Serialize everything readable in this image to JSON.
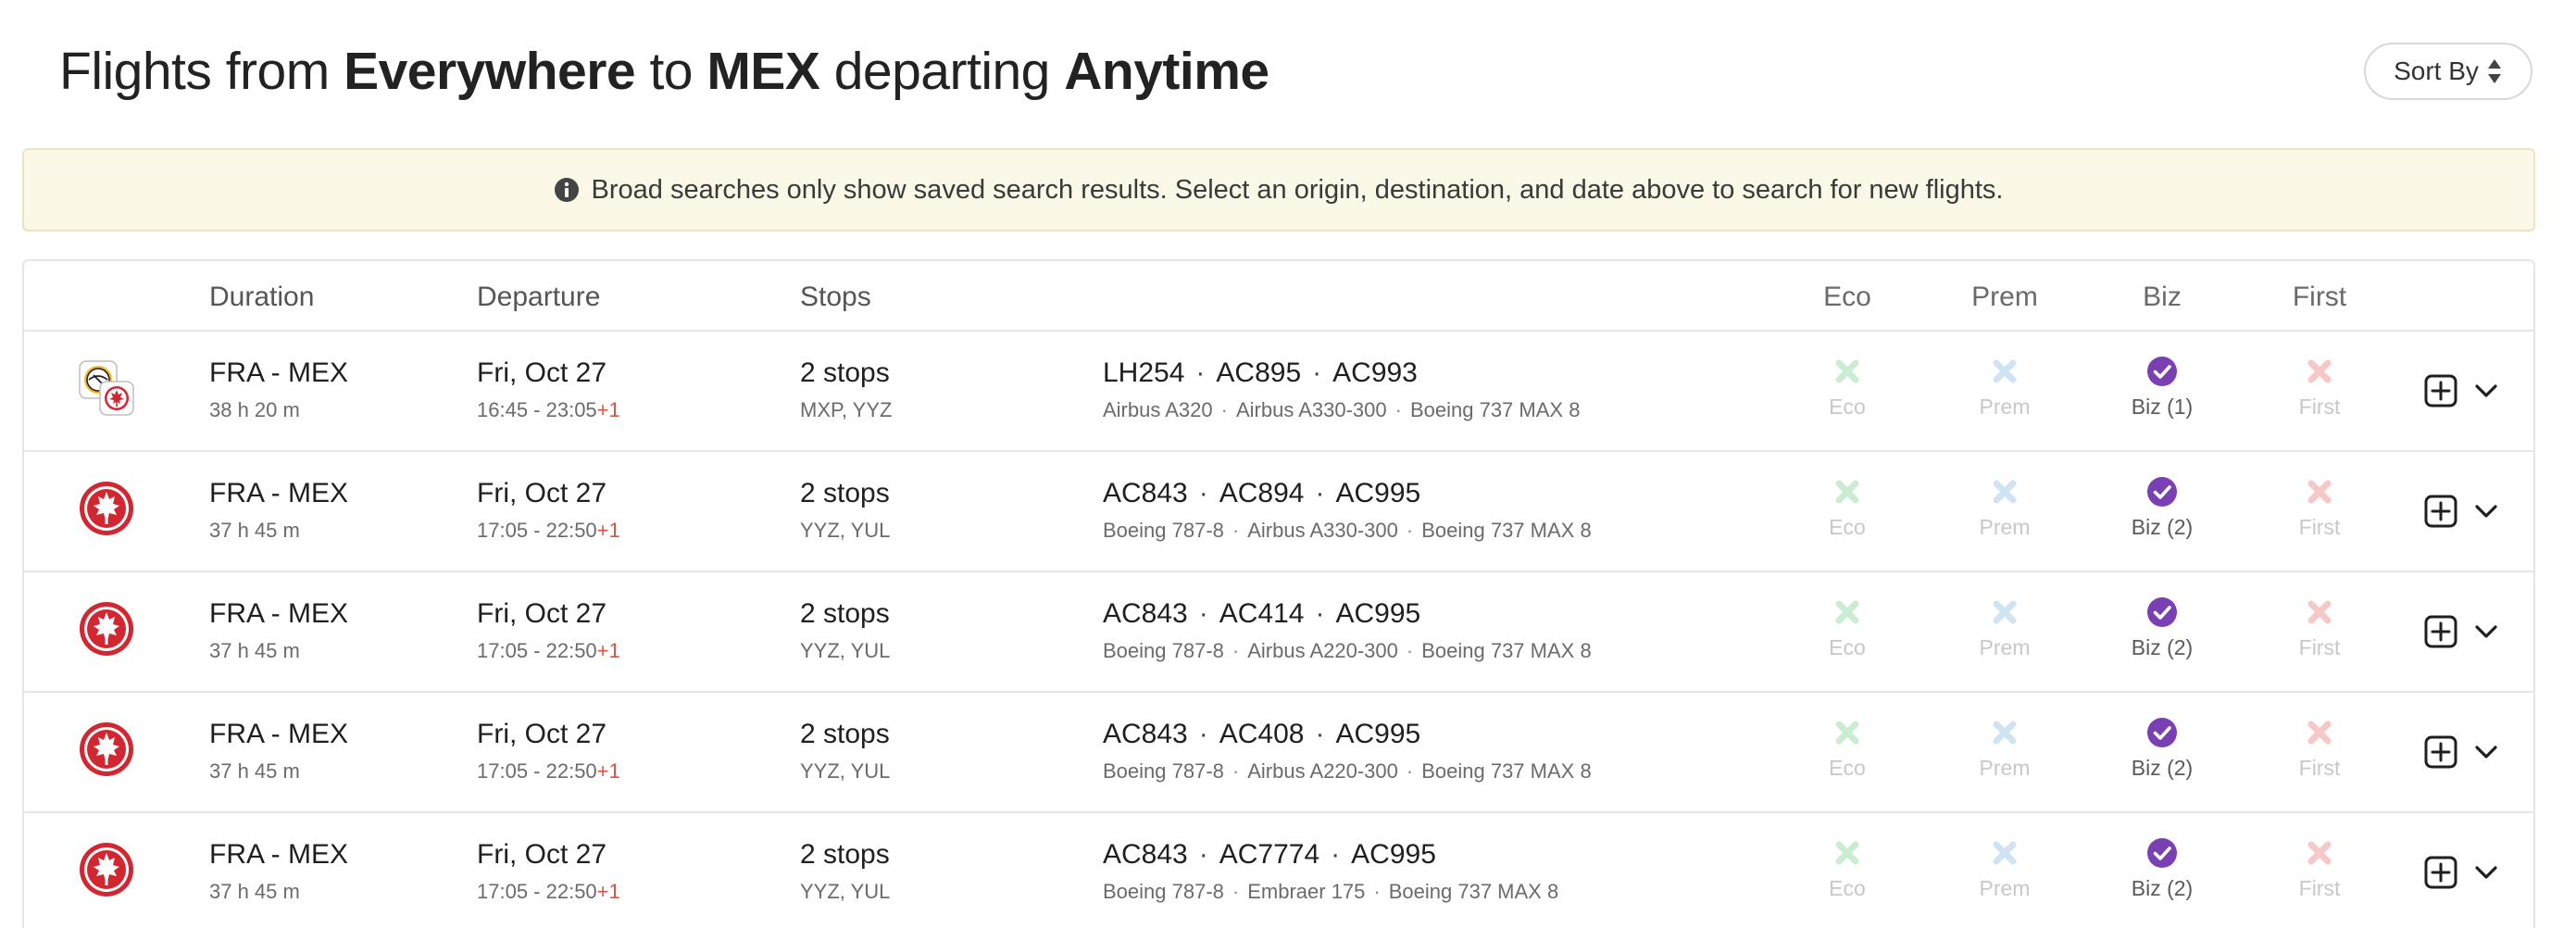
{
  "header": {
    "prefix": "Flights from ",
    "origin": "Everywhere",
    "middle": " to ",
    "destination": "MEX",
    "departing_word": " departing ",
    "when": "Anytime",
    "sort_label": "Sort By"
  },
  "notice": {
    "text": "Broad searches only show saved search results. Select an origin, destination, and date above to search for new flights."
  },
  "columns": {
    "duration": "Duration",
    "departure": "Departure",
    "stops": "Stops",
    "eco": "Eco",
    "prem": "Prem",
    "biz": "Biz",
    "first": "First"
  },
  "colors": {
    "eco_unavail": "#c9ecd3",
    "prem_unavail": "#cfe3f3",
    "biz_avail": "#7a3fb2",
    "first_unavail": "#f6c8c8",
    "plus_day": "#e0523f",
    "notice_bg": "#fcf8e8"
  },
  "flights": [
    {
      "airline_icon": "lufthansa-aircanada-logo",
      "route": "FRA - MEX",
      "duration": "38 h 20 m",
      "date": "Fri, Oct 27",
      "times": "16:45 - 23:05",
      "plus_day": "+1",
      "stops": "2 stops",
      "stop_codes": "MXP, YYZ",
      "flights": [
        "LH254",
        "AC895",
        "AC993"
      ],
      "aircraft": [
        "Airbus A320",
        "Airbus A330-300",
        "Boeing 737 MAX 8"
      ],
      "eco": "Eco",
      "prem": "Prem",
      "biz": "Biz (1)",
      "first": "First"
    },
    {
      "airline_icon": "aircanada-logo",
      "route": "FRA - MEX",
      "duration": "37 h 45 m",
      "date": "Fri, Oct 27",
      "times": "17:05 - 22:50",
      "plus_day": "+1",
      "stops": "2 stops",
      "stop_codes": "YYZ, YUL",
      "flights": [
        "AC843",
        "AC894",
        "AC995"
      ],
      "aircraft": [
        "Boeing 787-8",
        "Airbus A330-300",
        "Boeing 737 MAX 8"
      ],
      "eco": "Eco",
      "prem": "Prem",
      "biz": "Biz (2)",
      "first": "First"
    },
    {
      "airline_icon": "aircanada-logo",
      "route": "FRA - MEX",
      "duration": "37 h 45 m",
      "date": "Fri, Oct 27",
      "times": "17:05 - 22:50",
      "plus_day": "+1",
      "stops": "2 stops",
      "stop_codes": "YYZ, YUL",
      "flights": [
        "AC843",
        "AC414",
        "AC995"
      ],
      "aircraft": [
        "Boeing 787-8",
        "Airbus A220-300",
        "Boeing 737 MAX 8"
      ],
      "eco": "Eco",
      "prem": "Prem",
      "biz": "Biz (2)",
      "first": "First"
    },
    {
      "airline_icon": "aircanada-logo",
      "route": "FRA - MEX",
      "duration": "37 h 45 m",
      "date": "Fri, Oct 27",
      "times": "17:05 - 22:50",
      "plus_day": "+1",
      "stops": "2 stops",
      "stop_codes": "YYZ, YUL",
      "flights": [
        "AC843",
        "AC408",
        "AC995"
      ],
      "aircraft": [
        "Boeing 787-8",
        "Airbus A220-300",
        "Boeing 737 MAX 8"
      ],
      "eco": "Eco",
      "prem": "Prem",
      "biz": "Biz (2)",
      "first": "First"
    },
    {
      "airline_icon": "aircanada-logo",
      "route": "FRA - MEX",
      "duration": "37 h 45 m",
      "date": "Fri, Oct 27",
      "times": "17:05 - 22:50",
      "plus_day": "+1",
      "stops": "2 stops",
      "stop_codes": "YYZ, YUL",
      "flights": [
        "AC843",
        "AC7774",
        "AC995"
      ],
      "aircraft": [
        "Boeing 787-8",
        "Embraer 175",
        "Boeing 737 MAX 8"
      ],
      "eco": "Eco",
      "prem": "Prem",
      "biz": "Biz (2)",
      "first": "First"
    }
  ]
}
